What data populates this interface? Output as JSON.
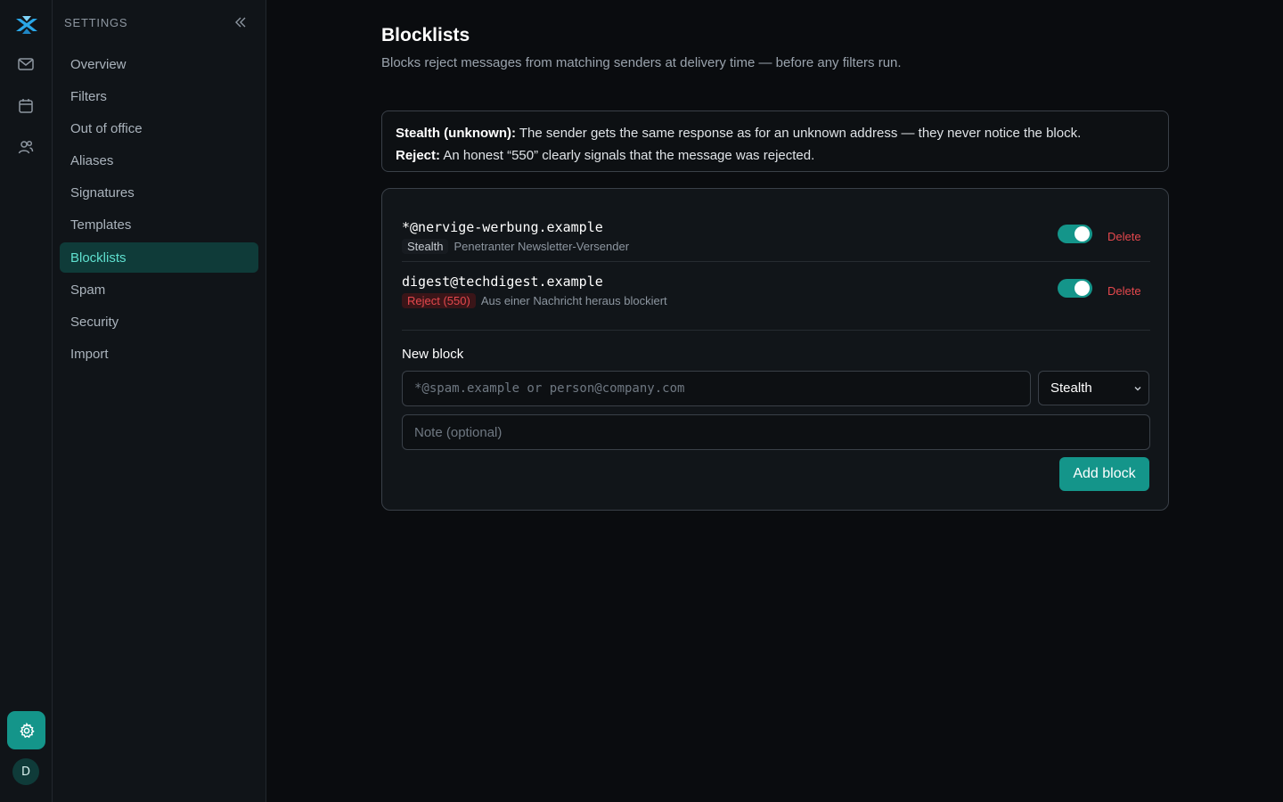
{
  "rail": {
    "icons": [
      "logo-icon",
      "mail-icon",
      "calendar-icon",
      "contacts-icon",
      "gear-icon"
    ],
    "avatar_initial": "D"
  },
  "sidebar": {
    "heading": "SETTINGS",
    "items": [
      {
        "label": "Overview"
      },
      {
        "label": "Filters"
      },
      {
        "label": "Out of office"
      },
      {
        "label": "Aliases"
      },
      {
        "label": "Signatures"
      },
      {
        "label": "Templates"
      },
      {
        "label": "Blocklists",
        "active": true
      },
      {
        "label": "Spam"
      },
      {
        "label": "Security"
      },
      {
        "label": "Import"
      }
    ]
  },
  "page": {
    "title": "Blocklists",
    "description": "Blocks reject messages from matching senders at delivery time — before any filters run."
  },
  "info": {
    "stealth_term": "Stealth (unknown):",
    "stealth_text": " The sender gets the same response as for an unknown address — they never notice the block.",
    "reject_term": "Reject:",
    "reject_text": " An honest “550” clearly signals that the message was rejected."
  },
  "blocks": [
    {
      "address": "*@nervige-werbung.example",
      "mode": "Stealth",
      "note": "Penetranter Newsletter-Versender",
      "enabled": true,
      "delete_label": "Delete"
    },
    {
      "address": "digest@techdigest.example",
      "mode": "Reject (550)",
      "note": "Aus einer Nachricht heraus blockiert",
      "enabled": true,
      "delete_label": "Delete"
    }
  ],
  "new_block": {
    "label": "New block",
    "address_placeholder": "*@spam.example or person@company.com",
    "mode_selected": "Stealth",
    "note_placeholder": "Note (optional)",
    "add_label": "Add block"
  },
  "colors": {
    "accent": "#14958a",
    "active_text": "#5fe0cf",
    "danger": "#e5484d",
    "logo": "#2aa7e8"
  }
}
